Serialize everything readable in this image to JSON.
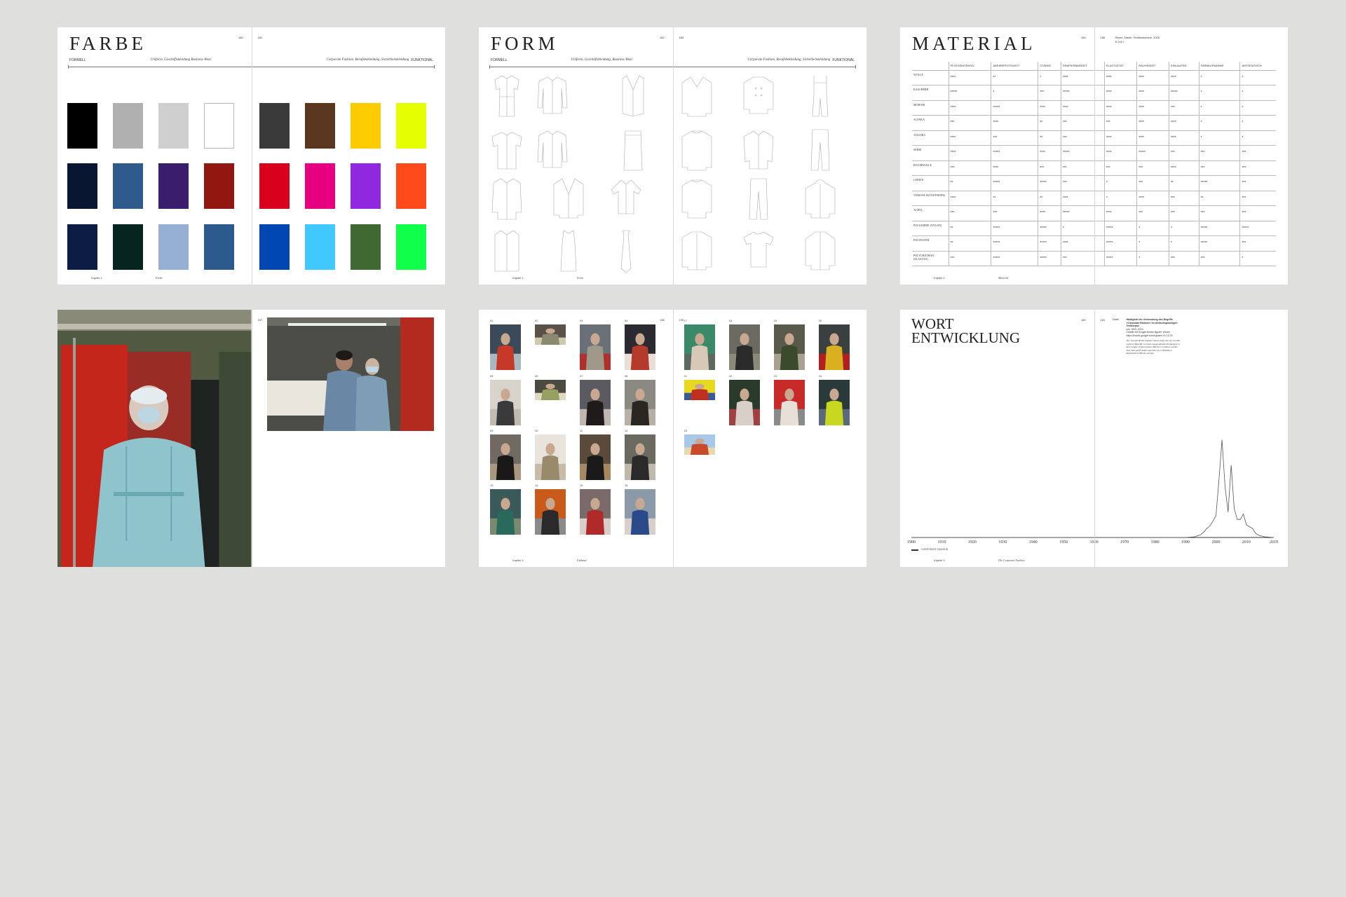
{
  "farbe": {
    "title": "FARBE",
    "page_left": "180",
    "page_right": "181",
    "left_tag": "FORMELL",
    "left_sub": "Uniform, Geschäftskleidung Business Wear",
    "right_sub": "Corporate Fashion, Berufsbekleidung, Sicherheitskleidung",
    "right_tag": "FUNKTIONAL",
    "foot_left": "Kapitel 4",
    "foot_mid": "Farbe",
    "swatches_left": [
      "#000000",
      "#b0b0b0",
      "#cfcfcf",
      "#ffffff",
      "#081631",
      "#2e5a8c",
      "#3a1e6c",
      "#921711",
      "#0c1c44",
      "#07251f",
      "#96b0d4",
      "#2d5a8c"
    ],
    "swatches_right": [
      "#3a3a3a",
      "#5a3820",
      "#fccb00",
      "#e5ff00",
      "#d8001c",
      "#e60080",
      "#9028e0",
      "#ff4a1c",
      "#0047b3",
      "#40c8ff",
      "#3f6930",
      "#0fff4a"
    ]
  },
  "form": {
    "title": "FORM",
    "page_left": "182",
    "page_right": "183",
    "left_tag": "FORMELL",
    "left_sub": "Uniform, Geschäftskleidung, Business Wear",
    "right_sub": "Corporate Fashion, Berufsbekleidung, Sicherheitskleidung",
    "right_tag": "FUNKTIONAL",
    "foot_left": "Kapitel 4",
    "foot_mid": "Form"
  },
  "material": {
    "title": "MATERIAL",
    "page_left": "184",
    "page_right": "185",
    "source_top": "Elsner, Naver: Textilmaschine. 2015",
    "source_sub": "S.142 f",
    "columns": [
      "PFLEGEINTENSIV",
      "ABRIEBFESTIGKEIT",
      "STÄRKE",
      "DRAPIERBARKEIT",
      "ELASTIZITÄT",
      "RAUHIGKEIT",
      "EINLAUFEN",
      "FARBAUFNAHME",
      "ANTISTATISCH"
    ],
    "rows": [
      {
        "name": "WOLLE",
        "values": [
          "****",
          "**",
          "*",
          "****",
          "****",
          "****",
          "****",
          "*",
          "*"
        ]
      },
      {
        "name": "KASCHMIR",
        "values": [
          "*****",
          "*",
          "***",
          "*****",
          "****",
          "****",
          "*****",
          "*",
          "*"
        ]
      },
      {
        "name": "MOHAIR",
        "values": [
          "****",
          "*****",
          "****",
          "****",
          "****",
          "****",
          "***",
          "*",
          "*"
        ]
      },
      {
        "name": "ALPAKA",
        "values": [
          "***",
          "****",
          "**",
          "***",
          "***",
          "****",
          "****",
          "*",
          "*"
        ]
      },
      {
        "name": "ANGORA",
        "values": [
          "****",
          "***",
          "**",
          "***",
          "****",
          "****",
          "****",
          "*",
          "*"
        ]
      },
      {
        "name": "SEIDE",
        "values": [
          "****",
          "*****",
          "****",
          "*****",
          "****",
          "*****",
          "***",
          "***",
          "***"
        ]
      },
      {
        "name": "BAUMWOLLE",
        "values": [
          "***",
          "****",
          "***",
          "***",
          "***",
          "***",
          "****",
          "***",
          "***"
        ]
      },
      {
        "name": "LEINEN",
        "values": [
          "**",
          "*****",
          "*****",
          "***",
          "*",
          "***",
          "**",
          "*****",
          "***"
        ]
      },
      {
        "name": "VISKOSE (KUNSTSEIDE)",
        "values": [
          "****",
          "**",
          "**",
          "****",
          "*",
          "****",
          "***",
          "**",
          "***"
        ]
      },
      {
        "name": "ACRYL",
        "values": [
          "***",
          "***",
          "****",
          "*****",
          "****",
          "***",
          "***",
          "***",
          "***"
        ]
      },
      {
        "name": "POLYAMIDE (NYLON)",
        "values": [
          "**",
          "*****",
          "*****",
          "*",
          "*****",
          "*",
          "*",
          "*****",
          "*****"
        ]
      },
      {
        "name": "POLYESTER",
        "values": [
          "**",
          "*****",
          "*****",
          "****",
          "*****",
          "*",
          "*",
          "*****",
          "***"
        ]
      },
      {
        "name": "POLYURETHAN (ELASTAN)",
        "values": [
          "***",
          "*****",
          "*****",
          "***",
          "*****",
          "*",
          "***",
          "***",
          "*"
        ]
      }
    ],
    "foot_left": "Kapitel 4",
    "foot_mid": "Material"
  },
  "photo": {
    "page_left": "196",
    "page_right": "197"
  },
  "grid": {
    "page_left": "198",
    "page_right": "199",
    "left_nums": [
      "01",
      "02",
      "03",
      "04",
      "05",
      "06",
      "07",
      "08",
      "09",
      "10",
      "11",
      "12",
      "13",
      "14",
      "15",
      "16"
    ],
    "right_nums": [
      "17",
      "18",
      "19",
      "20",
      "21",
      "22",
      "23",
      "24",
      "25"
    ],
    "foot_left": "Kapitel 4",
    "foot_mid": "Einband"
  },
  "wort": {
    "title_line1": "WORT",
    "title_line2": "ENTWICKLUNG",
    "page_left": "180",
    "page_right": "181",
    "note_label": "Grafik",
    "note_title": "Häufigkeit der Verwendung des Begriffs »Corporate Fashion« im deutschsprachigen Textkorpus",
    "note_lines": [
      "von 1900–2019",
      "Erstellt mit Google Books Ngram Viewer",
      "https://books.google.com/ngrams 01.10.20"
    ],
    "note_body": "Der Google Books Ngram Viewer zeigt wie oft ein oder mehrere Begriffe in einem ausgewählten Textkorpus in den Google eingescannten Büchern erwähnt wurden. Das Tool greift dabei auf mehr als 5 Millionen digitalisierte Bücher zurück.",
    "legend_label": "CORPORATE FASHION",
    "foot_left": "Kapitel 3",
    "foot_mid": "Die Corporate Fashion"
  },
  "chart_data": {
    "type": "line",
    "x": [
      1900,
      1980,
      1990,
      1993,
      1995,
      1996,
      1997,
      1998,
      1999,
      2000,
      2001,
      2002,
      2003,
      2004,
      2005,
      2006,
      2007,
      2008,
      2009,
      2010,
      2011,
      2012,
      2013,
      2014,
      2016,
      2019
    ],
    "y": [
      0,
      0,
      0,
      0.2,
      0.8,
      1.5,
      2.5,
      3.2,
      4.5,
      6,
      16,
      27,
      14,
      7,
      20,
      8,
      5,
      5,
      6.5,
      3.5,
      3,
      2.5,
      1.2,
      0.6,
      0.2,
      0
    ],
    "x_ticks": [
      "1900",
      "1910",
      "1920",
      "1930",
      "1940",
      "1950",
      "1960",
      "1970",
      "1980",
      "1990",
      "2000",
      "2010",
      "2019"
    ],
    "xlim": [
      1900,
      2019
    ],
    "ylim": [
      0,
      30
    ],
    "grid": false,
    "legend": "bottom-left",
    "series": [
      {
        "name": "CORPORATE FASHION"
      }
    ]
  }
}
